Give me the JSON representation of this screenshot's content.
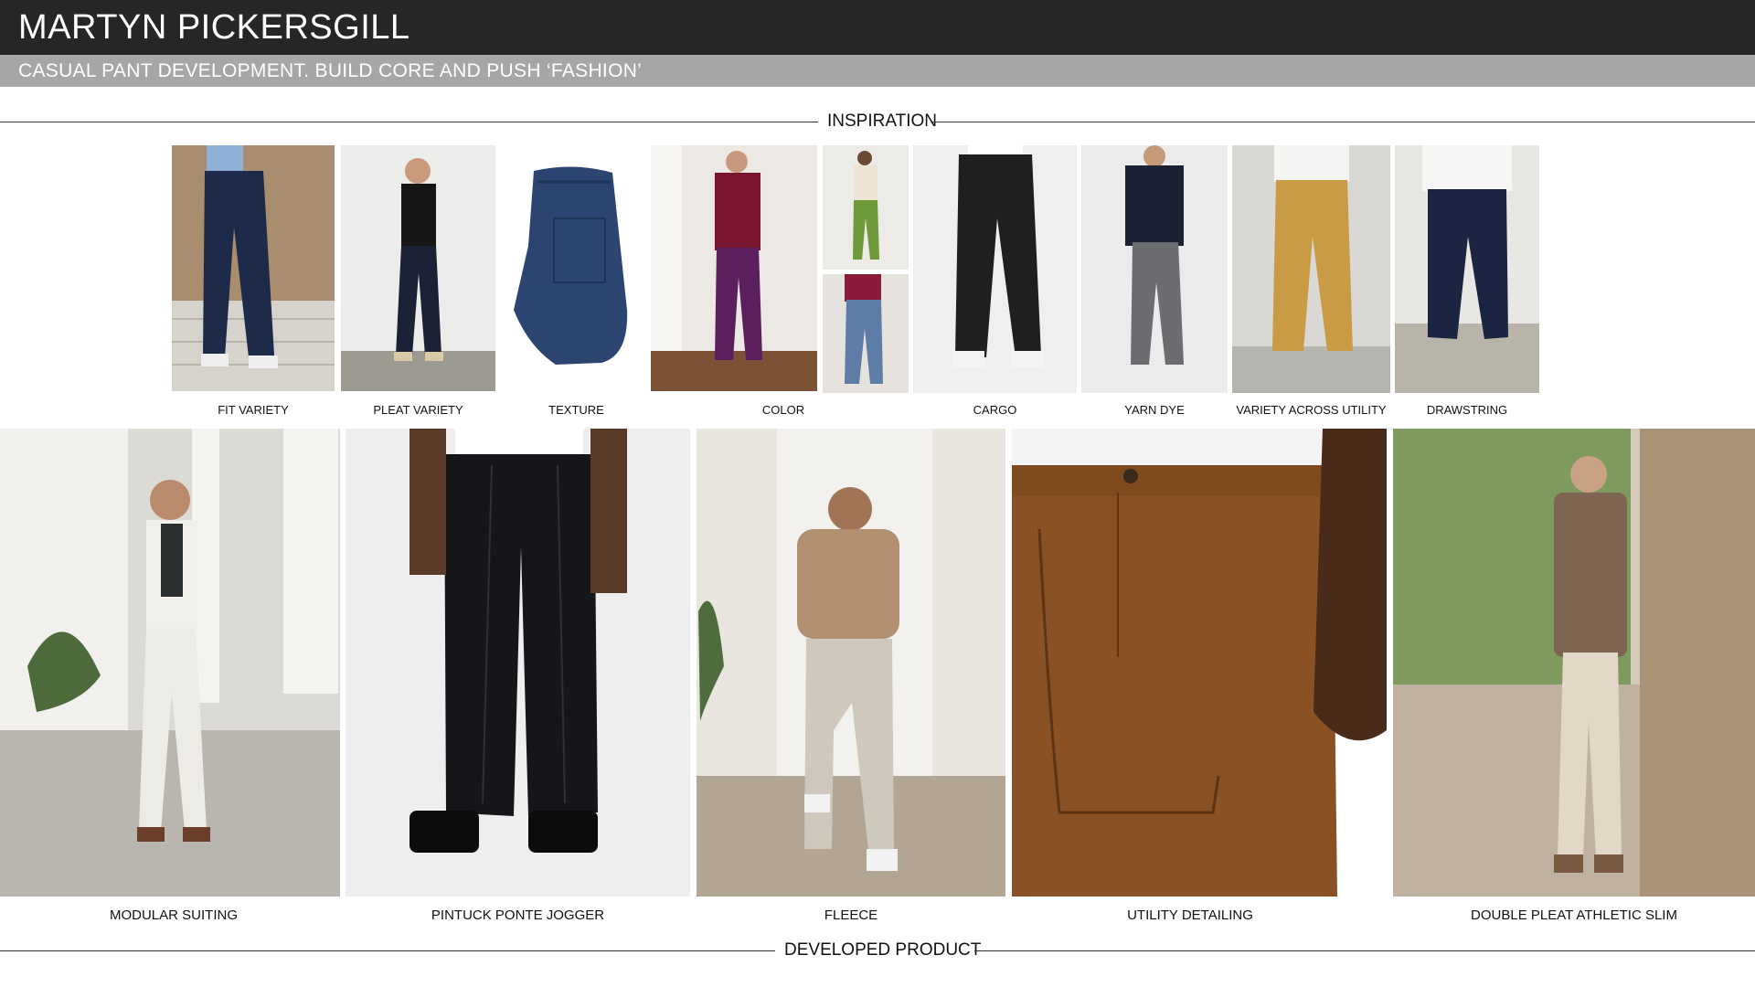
{
  "header": {
    "title": "MARTYN PICKERSGILL",
    "subtitle": "CASUAL PANT DEVELOPMENT. BUILD CORE AND PUSH ‘FASHION’"
  },
  "sections": {
    "inspiration": "INSPIRATION",
    "developed": "DEVELOPED PRODUCT"
  },
  "inspiration_items": [
    {
      "caption": "FIT VARIETY",
      "pant_color": "#1e2a4a"
    },
    {
      "caption": "PLEAT VARIETY",
      "pant_color": "#1c2236"
    },
    {
      "caption": "TEXTURE",
      "pant_color": "#2b4470"
    },
    {
      "caption": "COLOR",
      "pant_color": "#5a1f5c"
    },
    {
      "caption": "CARGO",
      "pant_color": "#1f1f22"
    },
    {
      "caption": "YARN DYE",
      "pant_color": "#6b6d70"
    },
    {
      "caption": "VARIETY ACROSS UTILITY",
      "pant_color": "#c99b45"
    },
    {
      "caption": "DRAWSTRING",
      "pant_color": "#1b2542"
    }
  ],
  "developed_items": [
    {
      "caption": "MODULAR SUITING",
      "pant_color": "#ecebe6"
    },
    {
      "caption": "PINTUCK PONTE JOGGER",
      "pant_color": "#15161a"
    },
    {
      "caption": "FLEECE",
      "pant_color": "#cfc8bd"
    },
    {
      "caption": "UTILITY DETAILING",
      "pant_color": "#8a5224"
    },
    {
      "caption": "DOUBLE PLEAT ATHLETIC SLIM",
      "pant_color": "#e3d8c8"
    }
  ]
}
